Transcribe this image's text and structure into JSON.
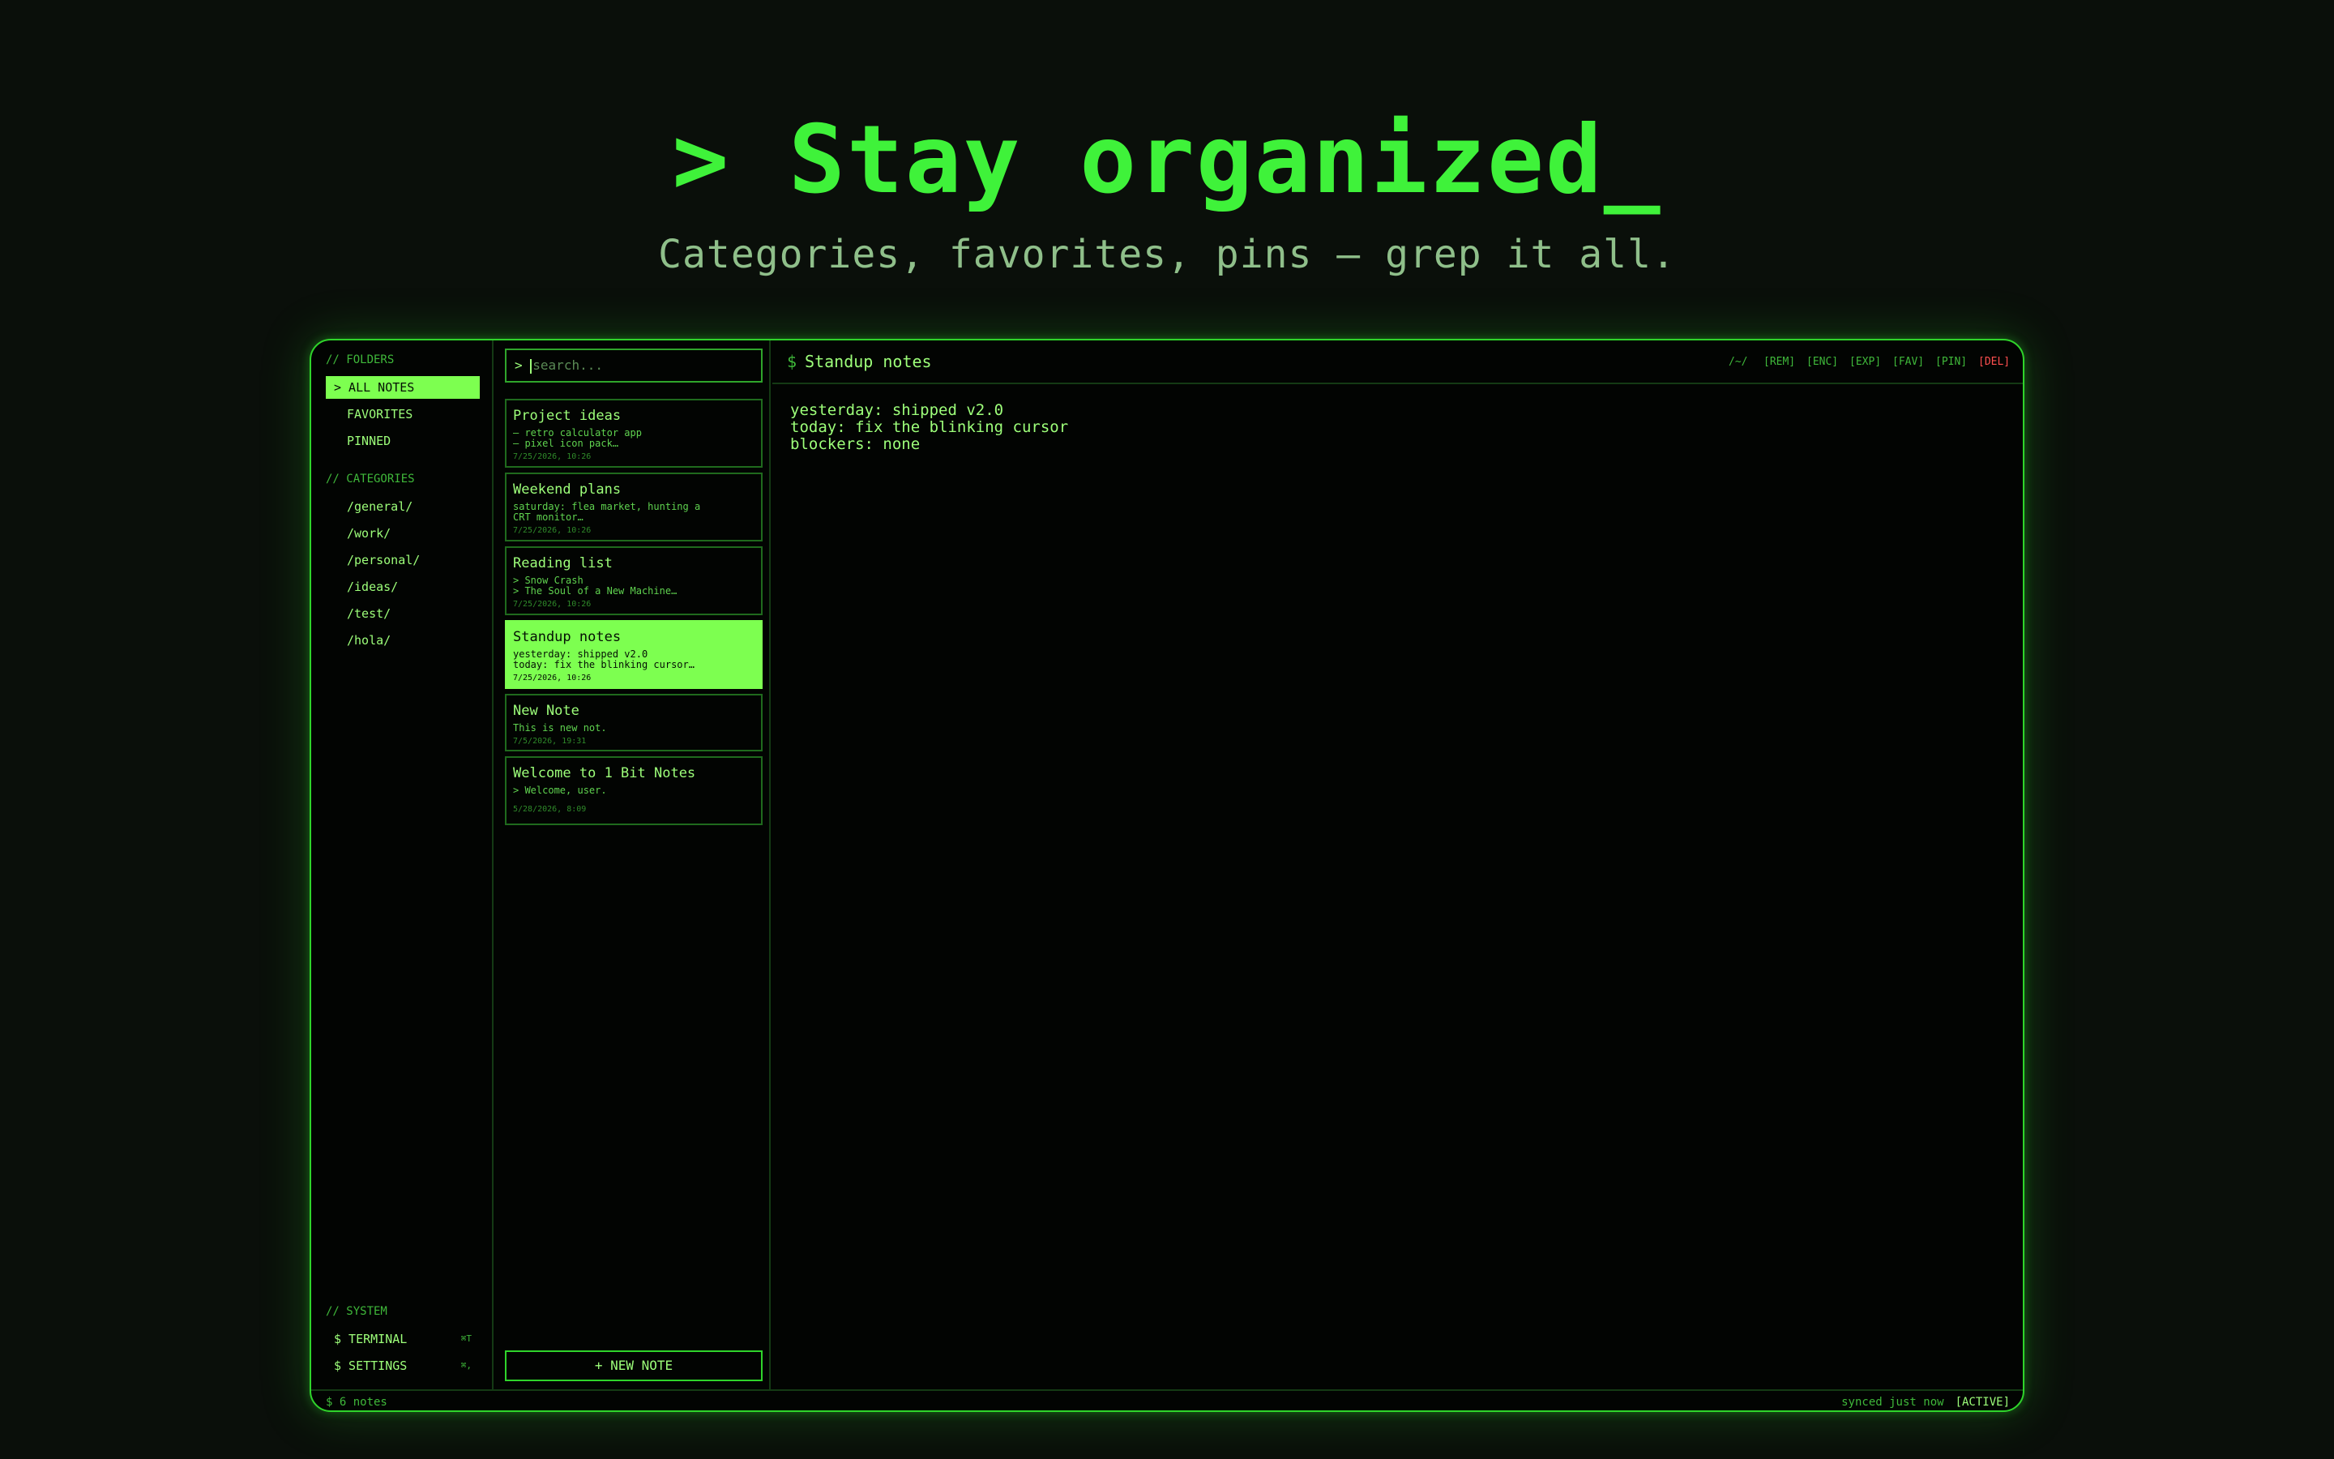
{
  "hero": {
    "title": "> Stay organized_",
    "subtitle": "Categories, favorites, pins — grep it all."
  },
  "sidebar": {
    "folders_label": "// FOLDERS",
    "folders": [
      {
        "label": "> ALL NOTES",
        "active": true
      },
      {
        "label": "FAVORITES",
        "active": false
      },
      {
        "label": "PINNED",
        "active": false
      }
    ],
    "categories_label": "// CATEGORIES",
    "categories": [
      "/general/",
      "/work/",
      "/personal/",
      "/ideas/",
      "/test/",
      "/hola/"
    ],
    "system_label": "// SYSTEM",
    "system": [
      {
        "label": "$ TERMINAL",
        "shortcut": "⌘T"
      },
      {
        "label": "$ SETTINGS",
        "shortcut": "⌘,"
      }
    ]
  },
  "notes_list": {
    "search_placeholder": "search...",
    "search_prompt": ">",
    "notes": [
      {
        "title": "Project ideas",
        "preview": "— retro calculator app\n— pixel icon pack…",
        "date": "7/25/2026, 10:26",
        "active": false
      },
      {
        "title": "Weekend plans",
        "preview": "saturday: flea market, hunting a\nCRT monitor…",
        "date": "7/25/2026, 10:26",
        "active": false
      },
      {
        "title": "Reading list",
        "preview": "> Snow Crash\n> The Soul of a New Machine…",
        "date": "7/25/2026, 10:26",
        "active": false
      },
      {
        "title": "Standup notes",
        "preview": "yesterday: shipped v2.0\ntoday: fix the blinking cursor…",
        "date": "7/25/2026, 10:26",
        "active": true
      },
      {
        "title": "New Note",
        "preview": "This is new not.",
        "date": "7/5/2026, 19:31",
        "active": false
      },
      {
        "title": "Welcome to 1 Bit Notes",
        "preview": "> Welcome, user.",
        "date": "5/28/2026, 8:09",
        "active": false
      }
    ],
    "new_note_label": "+ NEW NOTE"
  },
  "editor": {
    "prompt": "$",
    "title": "Standup notes",
    "toolbar": [
      "/~/",
      "[REM]",
      "[ENC]",
      "[EXP]",
      "[FAV]",
      "[PIN]",
      "[DEL]"
    ],
    "body": [
      "yesterday: shipped v2.0",
      "today: fix the blinking cursor",
      "blockers: none"
    ]
  },
  "status": {
    "count": "$ 6 notes",
    "sync": "synced just now",
    "badge": "[ACTIVE]"
  },
  "colors": {
    "accent": "#7dff50",
    "title": "#3ff23a",
    "danger": "#ff4f4f",
    "background": "#0a0f0a"
  }
}
